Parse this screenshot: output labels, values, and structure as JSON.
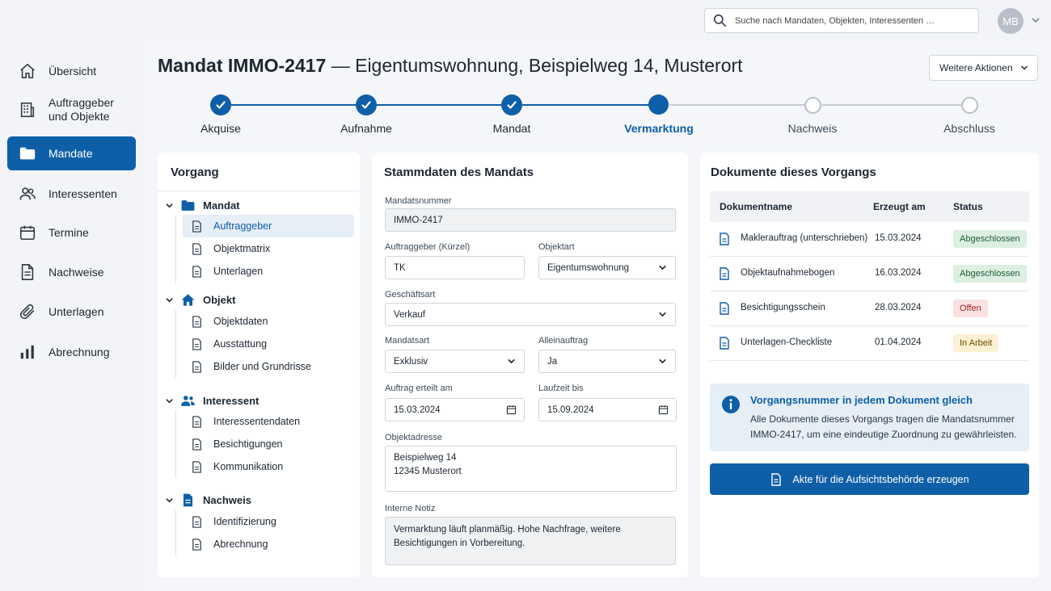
{
  "header": {
    "search_placeholder": "Suche nach Mandaten, Objekten, Interessenten …",
    "avatar_initials": "MB"
  },
  "sidebar": {
    "items": [
      {
        "label": "Übersicht",
        "icon": "home-icon"
      },
      {
        "label": "Auftraggeber\nund Objekte",
        "icon": "building-icon"
      },
      {
        "label": "Mandate",
        "icon": "folder-icon",
        "active": true
      },
      {
        "label": "Interessenten",
        "icon": "users-icon"
      },
      {
        "label": "Termine",
        "icon": "calendar-icon"
      },
      {
        "label": "Nachweise",
        "icon": "document-icon"
      },
      {
        "label": "Unterlagen",
        "icon": "paperclip-icon"
      },
      {
        "label": "Abrechnung",
        "icon": "bar-chart-icon"
      }
    ]
  },
  "page": {
    "title_bold": "Mandat IMMO-2417",
    "title_rest": " — Eigentumswohnung, Beispielweg 14, Musterort",
    "actions_label": "Weitere Aktionen"
  },
  "stepper": {
    "steps": [
      {
        "label": "Akquise",
        "state": "done"
      },
      {
        "label": "Aufnahme",
        "state": "done"
      },
      {
        "label": "Mandat",
        "state": "done"
      },
      {
        "label": "Vermarktung",
        "state": "current"
      },
      {
        "label": "Nachweis",
        "state": "future"
      },
      {
        "label": "Abschluss",
        "state": "future"
      }
    ]
  },
  "vorgang": {
    "title": "Vorgang",
    "groups": [
      {
        "label": "Mandat",
        "icon": "folder-icon",
        "items": [
          "Auftraggeber",
          "Objektmatrix",
          "Unterlagen"
        ]
      },
      {
        "label": "Objekt",
        "icon": "house-icon",
        "items": [
          "Objektdaten",
          "Ausstattung",
          "Bilder und Grundrisse"
        ]
      },
      {
        "label": "Interessent",
        "icon": "users-icon",
        "items": [
          "Interessentendaten",
          "Besichtigungen",
          "Kommunikation"
        ]
      },
      {
        "label": "Nachweis",
        "icon": "document-icon",
        "items": [
          "Identifizierung",
          "Abrechnung"
        ]
      }
    ]
  },
  "stammdaten": {
    "title": "Stammdaten des Mandats",
    "mandatsnummer_label": "Mandatsnummer",
    "mandatsnummer_value": "IMMO-2417",
    "auftraggeber_label": "Auftraggeber (Kürzel)",
    "auftraggeber_value": "TK",
    "objektart_label": "Objektart",
    "objektart_value": "Eigentumswohnung",
    "geschaeftsart_label": "Geschäftsart",
    "geschaeftsart_value": "Verkauf",
    "mandatsart_label": "Mandatsart",
    "mandatsart_value": "Exklusiv",
    "alleinauftrag_label": "Alleinauftrag",
    "alleinauftrag_value": "Ja",
    "auftrag_label": "Auftrag erteilt am",
    "auftrag_value": "15.03.2024",
    "laufzeit_label": "Laufzeit bis",
    "laufzeit_value": "15.09.2024",
    "adresse_label": "Objektadresse",
    "adresse_value": "Beispielweg 14\n12345 Musterort",
    "notiz_label": "Interne Notiz",
    "notiz_value": "Vermarktung läuft planmäßig. Hohe Nachfrage, weitere Besichtigungen in Vorbereitung."
  },
  "dokumente": {
    "title": "Dokumente dieses Vorgangs",
    "col_name": "Dokumentname",
    "col_date": "Erzeugt am",
    "col_status": "Status",
    "rows": [
      {
        "name": "Maklerauftrag (unterschrieben)",
        "date": "15.03.2024",
        "status": "Abgeschlossen",
        "kind": "ok"
      },
      {
        "name": "Objektaufnahmebogen",
        "date": "16.03.2024",
        "status": "Abgeschlossen",
        "kind": "ok"
      },
      {
        "name": "Besichtigungsschein",
        "date": "28.03.2024",
        "status": "Offen",
        "kind": "open"
      },
      {
        "name": "Unterlagen-Checkliste",
        "date": "01.04.2024",
        "status": "In Arbeit",
        "kind": "work"
      }
    ],
    "info_title": "Vorgangsnummer in jedem Dokument gleich",
    "info_text": "Alle Dokumente dieses Vorgangs tragen die Mandatsnummer IMMO-2417, um eine eindeutige Zuordnung zu gewährleisten.",
    "button_label": "Akte für die Aufsichtsbehörde erzeugen"
  },
  "colors": {
    "accent": "#0f5fa8",
    "done_badge": "#dcefe1",
    "open_badge": "#fbe1e1",
    "work_badge": "#fcf1d2"
  }
}
